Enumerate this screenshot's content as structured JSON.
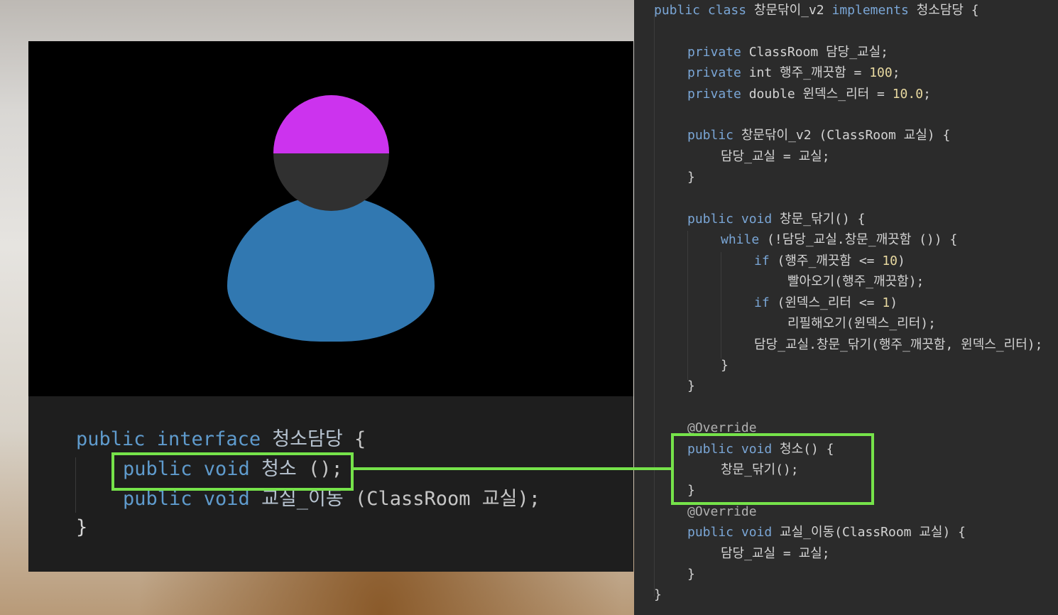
{
  "interface_code": {
    "line1": {
      "kw": "public interface ",
      "name": "청소담당",
      "tail": " {"
    },
    "line2": {
      "kw": "public void ",
      "name": "청소",
      "tail": " ();"
    },
    "line3": {
      "kw": "public void ",
      "name": "교실_이동",
      "tail": " (ClassRoom 교실);"
    },
    "line4": "}"
  },
  "class_code": {
    "l1": {
      "kw": "public class ",
      "name": "창문닦이_v2",
      "mid": " implements ",
      "tail": "청소담당 {"
    },
    "l2": {
      "kw": "private ",
      "rest": "ClassRoom 담당_교실;"
    },
    "l3": {
      "kw": "private ",
      "rest": "int 행주_깨끗함 = ",
      "num": "100",
      "end": ";"
    },
    "l4": {
      "kw": "private ",
      "rest": "double 윈덱스_리터 = ",
      "num": "10.0",
      "end": ";"
    },
    "l5": {
      "kw": "public ",
      "rest": "창문닦이_v2 (ClassRoom 교실) {"
    },
    "l6": "담당_교실 = 교실;",
    "l7": "}",
    "l8": {
      "kw": "public void ",
      "rest": "창문_닦기() {"
    },
    "l9": {
      "kw": "while ",
      "rest": "(!담당_교실.창문_깨끗함 ()) {"
    },
    "l10": {
      "kw": "if ",
      "rest": "(행주_깨끗함 <= ",
      "num": "10",
      "end": ")"
    },
    "l11": "빨아오기(행주_깨끗함);",
    "l12": {
      "kw": "if ",
      "rest": "(윈덱스_리터 <= ",
      "num": "1",
      "end": ")"
    },
    "l13": "리필해오기(윈덱스_리터);",
    "l14": "담당_교실.창문_닦기(행주_깨끗함, 윈덱스_리터);",
    "l15": "}",
    "l16": "}",
    "l17": "@Override",
    "l18": {
      "kw": "public void ",
      "rest": "청소() {"
    },
    "l19": "창문_닦기();",
    "l20": "}",
    "l21": "@Override",
    "l22": {
      "kw": "public void ",
      "rest": "교실_이동(ClassRoom 교실) {"
    },
    "l23": "담당_교실 = 교실;",
    "l24": "}",
    "l25": "}"
  },
  "colors": {
    "highlight": "#76e34a",
    "avatar_cap": "#cc33ee",
    "avatar_body": "#3178b1",
    "keyword": "#7aa6d6"
  }
}
